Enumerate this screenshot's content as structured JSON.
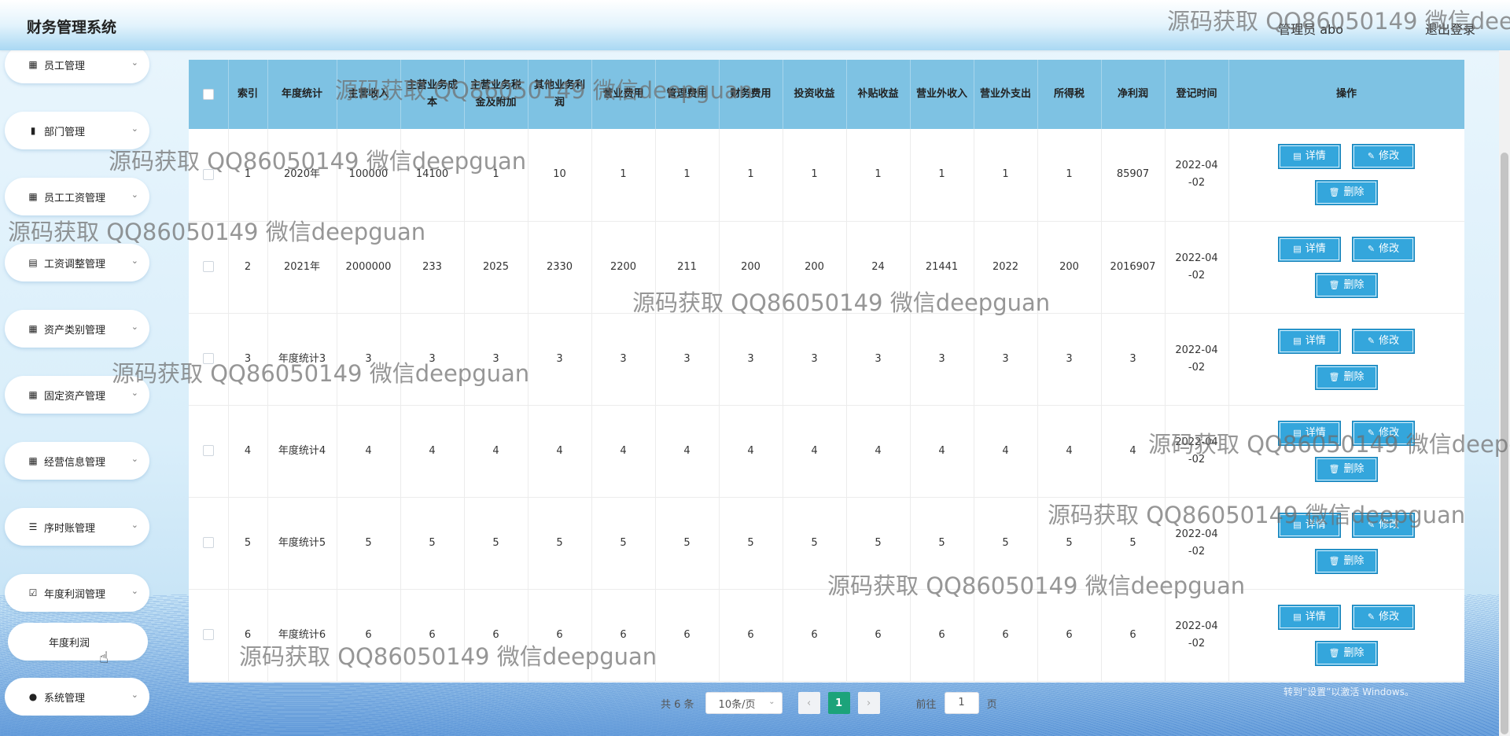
{
  "header": {
    "title": "财务管理系统",
    "user": "管理员 abo",
    "logout": "退出登录"
  },
  "sidebar": {
    "items": [
      {
        "label": "员工管理",
        "icon": "grid-icon"
      },
      {
        "label": "部门管理",
        "icon": "bar-chart-icon"
      },
      {
        "label": "员工工资管理",
        "icon": "grid-icon"
      },
      {
        "label": "工资调整管理",
        "icon": "clipboard-icon"
      },
      {
        "label": "资产类别管理",
        "icon": "grid-icon"
      },
      {
        "label": "固定资产管理",
        "icon": "grid-icon"
      },
      {
        "label": "经营信息管理",
        "icon": "grid-icon"
      },
      {
        "label": "序时账管理",
        "icon": "list-icon"
      },
      {
        "label": "年度利润管理",
        "icon": "clipboard-check-icon"
      }
    ],
    "active_sub_item": "年度利润",
    "last_item": {
      "label": "系统管理",
      "icon": "user-icon"
    }
  },
  "table": {
    "headers": [
      "索引",
      "年度统计",
      "主营收入",
      "主营业务成本",
      "主营业务税金及附加",
      "其他业务利润",
      "营业费用",
      "管理费用",
      "财务费用",
      "投资收益",
      "补贴收益",
      "营业外收入",
      "营业外支出",
      "所得税",
      "净利润",
      "登记时间",
      "操作"
    ],
    "rows": [
      [
        "1",
        "2020年",
        "100000",
        "14100",
        "1",
        "10",
        "1",
        "1",
        "1",
        "1",
        "1",
        "1",
        "1",
        "1",
        "85907",
        "2022-04-02"
      ],
      [
        "2",
        "2021年",
        "2000000",
        "233",
        "2025",
        "2330",
        "2200",
        "211",
        "200",
        "200",
        "24",
        "21441",
        "2022",
        "200",
        "2016907",
        "2022-04-02"
      ],
      [
        "3",
        "年度统计3",
        "3",
        "3",
        "3",
        "3",
        "3",
        "3",
        "3",
        "3",
        "3",
        "3",
        "3",
        "3",
        "3",
        "2022-04-02"
      ],
      [
        "4",
        "年度统计4",
        "4",
        "4",
        "4",
        "4",
        "4",
        "4",
        "4",
        "4",
        "4",
        "4",
        "4",
        "4",
        "4",
        "2022-04-02"
      ],
      [
        "5",
        "年度统计5",
        "5",
        "5",
        "5",
        "5",
        "5",
        "5",
        "5",
        "5",
        "5",
        "5",
        "5",
        "5",
        "5",
        "2022-04-02"
      ],
      [
        "6",
        "年度统计6",
        "6",
        "6",
        "6",
        "6",
        "6",
        "6",
        "6",
        "6",
        "6",
        "6",
        "6",
        "6",
        "6",
        "2022-04-02"
      ]
    ],
    "actions": {
      "detail": "详情",
      "edit": "修改",
      "delete": "删除"
    }
  },
  "pagination": {
    "total": "共 6 条",
    "page_size": "10条/页",
    "current_page": "1",
    "goto_label": "前往",
    "goto_value": "1",
    "page_unit": "页"
  },
  "watermark": "源码获取 QQ86050149 微信deepguan",
  "windows_activation": {
    "line1": "激活 Windows",
    "line2": "转到“设置”以激活 Windows。"
  },
  "colors": {
    "header_bg": "#a9d8f3",
    "table_header_bg": "#7ec2e3",
    "button_bg": "#34a6dc",
    "active_page": "#1ca37a"
  }
}
